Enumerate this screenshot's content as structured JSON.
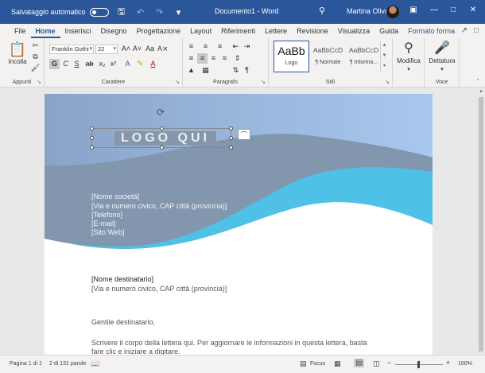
{
  "titlebar": {
    "autosave_label": "Salvataggio automatico",
    "document_title": "Documento1  -  Word",
    "user_name": "Martina Oliva",
    "bg_color": "#2b579a"
  },
  "tabs": [
    {
      "label": "File"
    },
    {
      "label": "Home"
    },
    {
      "label": "Inserisci"
    },
    {
      "label": "Disegno"
    },
    {
      "label": "Progettazione"
    },
    {
      "label": "Layout"
    },
    {
      "label": "Riferimenti"
    },
    {
      "label": "Lettere"
    },
    {
      "label": "Revisione"
    },
    {
      "label": "Visualizza"
    },
    {
      "label": "Guida"
    },
    {
      "label": "Formato forma"
    }
  ],
  "ribbon": {
    "clipboard": {
      "paste_label": "Incolla",
      "group_label": "Appunti"
    },
    "font": {
      "font_name": "Franklin Gothi",
      "font_size": "22",
      "group_label": "Carattere",
      "bold": "G",
      "italic": "C",
      "underline": "S"
    },
    "paragraph": {
      "group_label": "Paragrafo"
    },
    "styles": {
      "group_label": "Stili",
      "items": [
        {
          "sample": "AaBb",
          "name": "Logo"
        },
        {
          "sample": "AaBbCcD",
          "name": "¶ Normale"
        },
        {
          "sample": "AaBbCcD",
          "name": "¶ Informa..."
        }
      ]
    },
    "editing": {
      "label": "Modifica"
    },
    "voice": {
      "label": "Dettatura",
      "group_label": "Voce"
    }
  },
  "document": {
    "logo_text": "LOGO QUI",
    "sender": [
      "[Nome società]",
      "[Via e numero civico, CAP città (provincia)]",
      "[Telefono]",
      "[E-mail]",
      "[Sito Web]"
    ],
    "recipient_name": "[Nome destinatario]",
    "recipient_address": "[Via e numero civico, CAP città (provincia)]",
    "greeting": "Gentile destinatario,",
    "body_line1": "Scrivere il corpo della lettera qui. Per aggiornare le informazioni in questa lettera, basta",
    "body_line2": "fare clic e iniziare a digitare."
  },
  "statusbar": {
    "page": "Pagina 1 di 1",
    "words": "2 di 131 parole",
    "focus": "Focus",
    "zoom": "100%"
  }
}
